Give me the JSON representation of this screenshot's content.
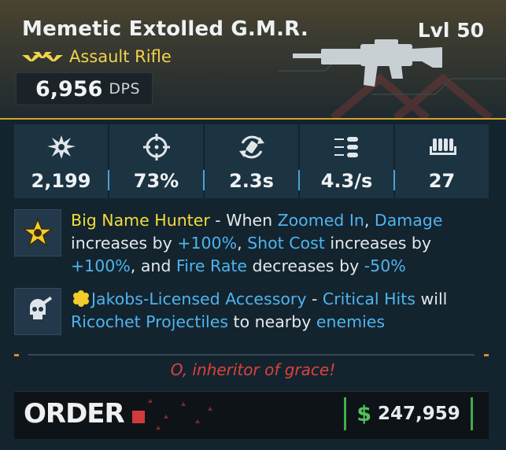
{
  "item": {
    "name": "Memetic Extolled G.M.R.",
    "level": "Lvl 50",
    "type": "Assault Rifle",
    "dps_value": "6,956",
    "dps_unit": "DPS",
    "rarity_color": "#f2d24a"
  },
  "stats": [
    {
      "icon": "damage-burst-icon",
      "value": "2,199"
    },
    {
      "icon": "accuracy-crosshair-icon",
      "value": "73%"
    },
    {
      "icon": "reload-icon",
      "value": "2.3s"
    },
    {
      "icon": "fire-rate-icon",
      "value": "4.3/s"
    },
    {
      "icon": "magazine-ammo-icon",
      "value": "27"
    }
  ],
  "perks": [
    {
      "icon": "big-name-hunter-star-icon",
      "parts": [
        {
          "t": "Big Name Hunter",
          "c": "y"
        },
        {
          "t": " - When ",
          "c": ""
        },
        {
          "t": "Zoomed In",
          "c": "b"
        },
        {
          "t": ", ",
          "c": ""
        },
        {
          "t": "Damage",
          "c": "b"
        },
        {
          "t": " increases by ",
          "c": ""
        },
        {
          "t": "+100%",
          "c": "b"
        },
        {
          "t": ", ",
          "c": ""
        },
        {
          "t": "Shot Cost",
          "c": "b"
        },
        {
          "t": " increases by ",
          "c": ""
        },
        {
          "t": "+100%",
          "c": "b"
        },
        {
          "t": ", and ",
          "c": ""
        },
        {
          "t": "Fire Rate",
          "c": "b"
        },
        {
          "t": " decreases by ",
          "c": ""
        },
        {
          "t": "-50%",
          "c": "b"
        }
      ]
    },
    {
      "icon": "jakobs-skull-icon",
      "parts": [
        {
          "t": "Jakobs-Licensed Accessory",
          "c": "b"
        },
        {
          "t": " - ",
          "c": ""
        },
        {
          "t": "Critical Hits",
          "c": "b"
        },
        {
          "t": " will ",
          "c": ""
        },
        {
          "t": "Ricochet Projectiles",
          "c": "b"
        },
        {
          "t": " to nearby ",
          "c": ""
        },
        {
          "t": "enemies",
          "c": "b"
        }
      ]
    }
  ],
  "flavor_text": "O, inheritor of grace!",
  "manufacturer": "ORDER",
  "price": {
    "currency": "$",
    "value": "247,959"
  }
}
